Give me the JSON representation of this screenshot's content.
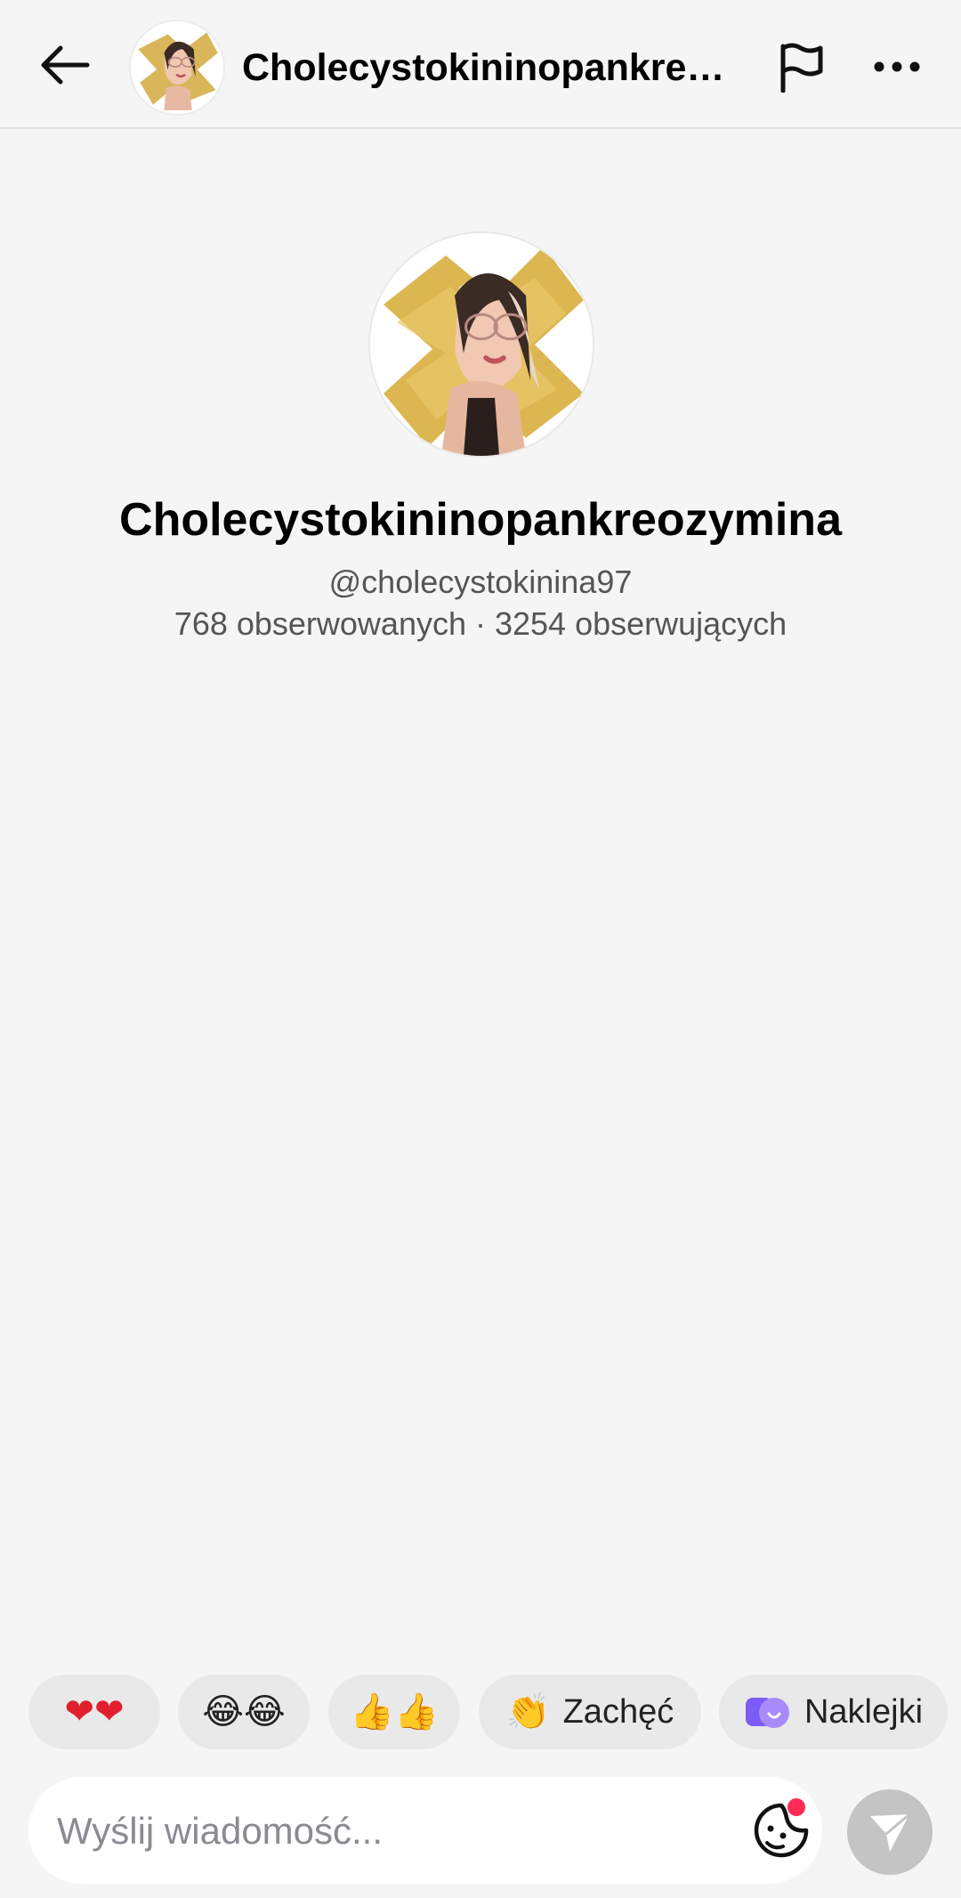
{
  "header": {
    "title": "Cholecystokininopankreo...",
    "back_icon": "arrow-left-icon",
    "flag_icon": "flag-icon",
    "more_icon": "more-horizontal-icon"
  },
  "profile": {
    "name": "Cholecystokininopankreozymina",
    "handle": "@cholecystokinina97",
    "stats": "768 obserwowanych · 3254 obserwujących"
  },
  "quick_replies": [
    {
      "emoji": "❤❤",
      "label": ""
    },
    {
      "emoji": "😂😂",
      "label": ""
    },
    {
      "emoji": "👍👍",
      "label": ""
    },
    {
      "emoji": "👏",
      "label": "Zachęć"
    },
    {
      "emoji": "",
      "label": "Naklejki"
    }
  ],
  "composer": {
    "placeholder": "Wyślij wiadomość...",
    "sticker_icon": "sticker-icon",
    "send_icon": "send-icon"
  },
  "colors": {
    "background": "#f5f5f5",
    "chip": "#e9e9e9",
    "send_disabled": "#c4c4c4",
    "notification_dot": "#fe2c55",
    "sticker_purple": "#7b5cf6"
  }
}
